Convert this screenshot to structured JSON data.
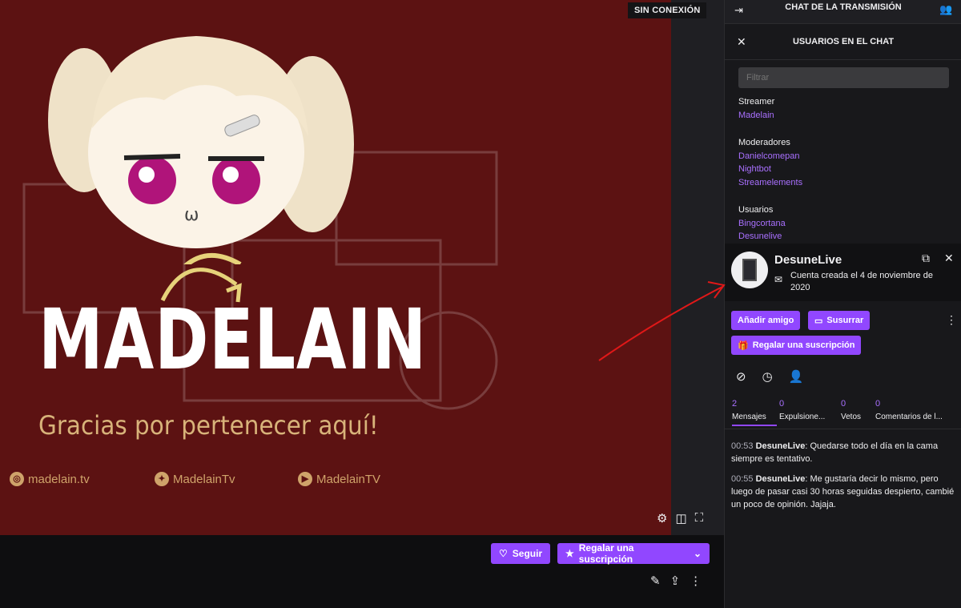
{
  "player": {
    "status_badge": "SIN CONEXIÓN",
    "channel_name": "MADELAIN",
    "tagline": "Gracias por pertenecer aquí!",
    "socials": [
      {
        "icon": "instagram-icon",
        "label": "madelain.tv"
      },
      {
        "icon": "twitter-icon",
        "label": "MadelainTv"
      },
      {
        "icon": "youtube-icon",
        "label": "MadelainTV"
      }
    ]
  },
  "actions": {
    "follow_label": "Seguir",
    "gift_sub_label": "Regalar una suscripción"
  },
  "chat": {
    "header_title": "CHAT DE LA TRANSMISIÓN",
    "users_title": "USUARIOS EN EL CHAT",
    "filter_placeholder": "Filtrar",
    "groups": {
      "streamer_label": "Streamer",
      "streamer": [
        "Madelain"
      ],
      "mods_label": "Moderadores",
      "mods": [
        "Danielcomepan",
        "Nightbot",
        "Streamelements"
      ],
      "users_label": "Usuarios",
      "users": [
        "Bingcortana",
        "Desunelive"
      ]
    }
  },
  "card": {
    "name": "DesuneLive",
    "created": "Cuenta creada el 4 de noviembre de 2020",
    "add_friend": "Añadir amigo",
    "whisper": "Susurrar",
    "gift_sub": "Regalar una suscripción",
    "tabs": [
      {
        "count": "2",
        "label": "Mensajes"
      },
      {
        "count": "0",
        "label": "Expulsione..."
      },
      {
        "count": "0",
        "label": "Vetos"
      },
      {
        "count": "0",
        "label": "Comentarios de l..."
      }
    ],
    "messages": [
      {
        "time": "00:53",
        "user": "DesuneLive",
        "text": ": Quedarse todo el día en la cama siempre es tentativo."
      },
      {
        "time": "00:55",
        "user": "DesuneLive",
        "text": ": Me gustaría decir lo mismo, pero luego de pasar casi 30 horas seguidas despierto, cambié un poco de opinión. Jajaja."
      }
    ]
  },
  "colors": {
    "accent": "#9147ff",
    "link": "#a970ff",
    "banner_bg": "#5c1212",
    "banner_text": "#d8b37a"
  }
}
